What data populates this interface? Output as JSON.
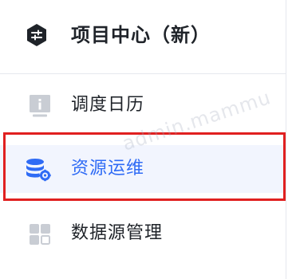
{
  "app": {
    "title": "项目中心（新）",
    "logo_icon": "settings-sliders-hexagon-icon"
  },
  "nav": {
    "items": [
      {
        "label": "调度日历",
        "icon": "info-document-icon",
        "active": false
      },
      {
        "label": "资源运维",
        "icon": "database-gear-icon",
        "active": true
      },
      {
        "label": "数据源管理",
        "icon": "grid-blocks-icon",
        "active": false
      }
    ]
  },
  "watermark": {
    "text": "admin.mammu"
  },
  "colors": {
    "accent": "#2f6bf5",
    "active_bg": "#f2f5fe",
    "highlight": "#e02020",
    "text": "#1f2329",
    "icon_gray": "#c9cdd4"
  }
}
